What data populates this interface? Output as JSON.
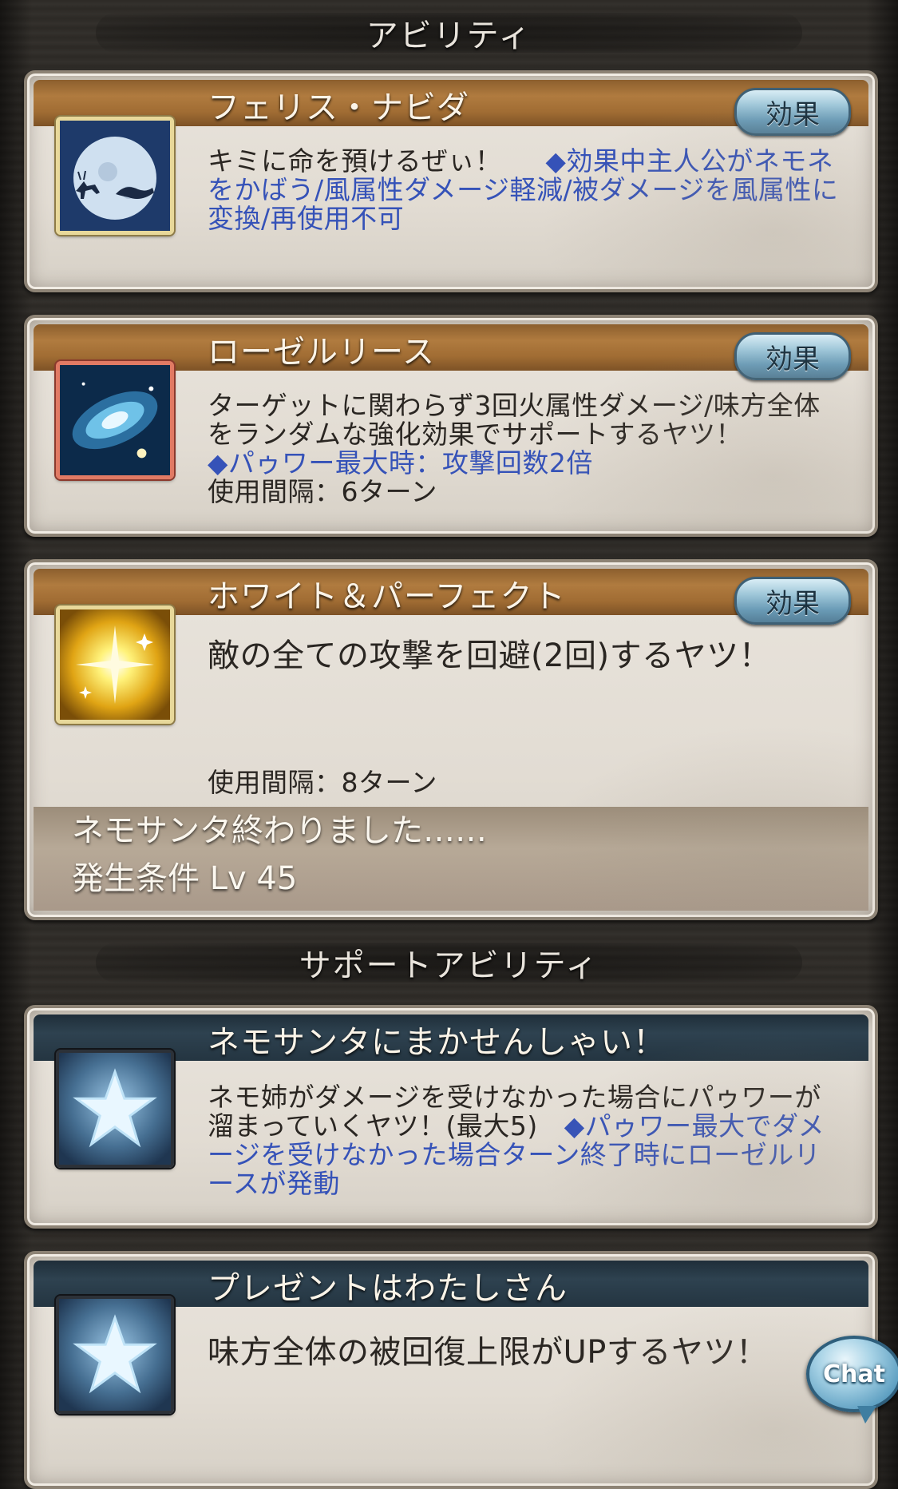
{
  "sections": {
    "abilities_title": "アビリティ",
    "support_title": "サポートアビリティ"
  },
  "abilities": [
    {
      "name": "フェリス・ナビダ",
      "button": "効果",
      "icon": "moon-reindeer-sleigh-icon",
      "desc_plain": "キミに命を預けるぜぃ！",
      "desc_blue": "◆効果中主人公がネモネをかばう/風属性ダメージ軽減/被ダメージを風属性に変換/再使用不可"
    },
    {
      "name": "ローゼルリース",
      "button": "効果",
      "icon": "galaxy-swirl-icon",
      "desc_plain": "ターゲットに関わらず3回火属性ダメージ/味方全体をランダムな強化効果でサポートするヤツ！",
      "desc_blue": "◆パゥワー最大時：攻撃回数2倍",
      "cooldown": "使用間隔：6ターン"
    },
    {
      "name": "ホワイト＆パーフェクト",
      "button": "効果",
      "icon": "golden-sparkle-icon",
      "desc_plain": "敵の全ての攻撃を回避(2回)するヤツ！",
      "cooldown": "使用間隔：8ターン",
      "condition_note": "ネモサンタ終わりました……",
      "condition_level": "発生条件 Lv 45"
    }
  ],
  "support_abilities": [
    {
      "name": "ネモサンタにまかせんしゃい！",
      "icon": "star-icon",
      "desc_plain": "ネモ姉がダメージを受けなかった場合にパゥワーが溜まっていくヤツ！(最大5)",
      "desc_blue": "◆パゥワー最大でダメージを受けなかった場合ターン終了時にローゼルリースが発動"
    },
    {
      "name": "プレゼントはわたしさん",
      "icon": "star-icon",
      "desc_plain": "味方全体の被回復上限がUPするヤツ！"
    }
  ],
  "chat_button": "Chat",
  "colors": {
    "gold_bar": "#a06c33",
    "navy_bar": "#2e4250",
    "blue_text": "#3552b8",
    "effect_button": "#6b9cb7"
  }
}
